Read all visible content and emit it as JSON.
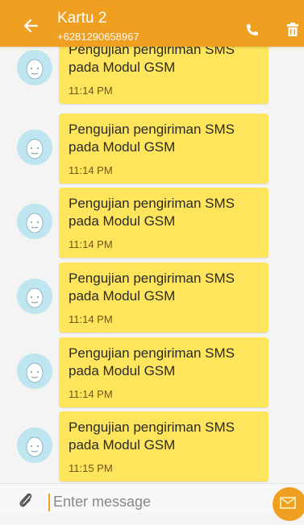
{
  "header": {
    "title": "Kartu 2",
    "subtitle": "+6281290658967",
    "back_icon": "back-arrow-icon",
    "call_icon": "phone-icon",
    "delete_icon": "trash-icon",
    "color": "#f0a020"
  },
  "messages": [
    {
      "text": "Pengujian pengiriman SMS pada Modul GSM",
      "time": "11:14 PM"
    },
    {
      "text": "Pengujian pengiriman SMS pada Modul GSM",
      "time": "11:14 PM"
    },
    {
      "text": "Pengujian pengiriman SMS pada Modul GSM",
      "time": "11:14 PM"
    },
    {
      "text": "Pengujian pengiriman SMS pada Modul GSM",
      "time": "11:14 PM"
    },
    {
      "text": "Pengujian pengiriman SMS pada Modul GSM",
      "time": "11:14 PM"
    },
    {
      "text": "Pengujian pengiriman SMS pada Modul GSM",
      "time": "11:15 PM"
    }
  ],
  "composer": {
    "placeholder": "Enter message",
    "attach_icon": "paperclip-icon",
    "send_icon": "send-envelope-icon"
  },
  "colors": {
    "accent": "#f0a020",
    "bubble": "#ffe55c",
    "avatar": "#bfe6f0"
  }
}
